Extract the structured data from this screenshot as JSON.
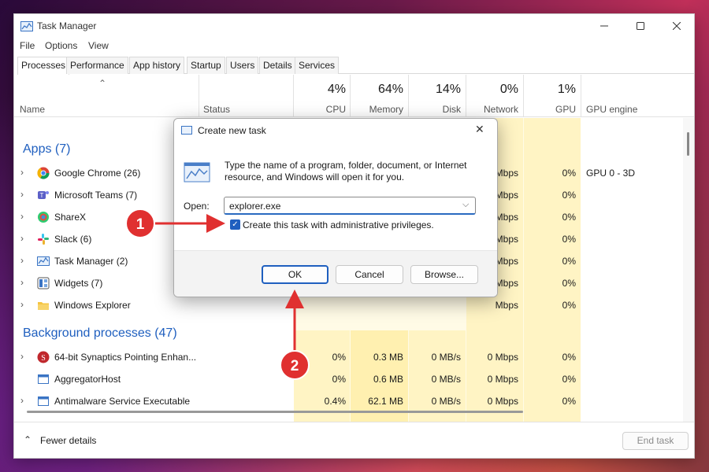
{
  "window": {
    "title": "Task Manager"
  },
  "menu": [
    "File",
    "Options",
    "View"
  ],
  "tabs": [
    "Processes",
    "Performance",
    "App history",
    "Startup",
    "Users",
    "Details",
    "Services"
  ],
  "columns": {
    "name": "Name",
    "status": "Status",
    "cpu": {
      "pct": "4%",
      "label": "CPU"
    },
    "memory": {
      "pct": "64%",
      "label": "Memory"
    },
    "disk": {
      "pct": "14%",
      "label": "Disk"
    },
    "network": {
      "pct": "0%",
      "label": "Network"
    },
    "gpu": {
      "pct": "1%",
      "label": "GPU"
    },
    "gpu_engine": "GPU engine"
  },
  "groups": {
    "apps": "Apps (7)",
    "background": "Background processes (47)"
  },
  "apps": [
    {
      "name": "Google Chrome (26)",
      "network": "Mbps",
      "gpu": "0%",
      "gpu_engine": "GPU 0 - 3D",
      "icon": "chrome-icon",
      "expand": true
    },
    {
      "name": "Microsoft Teams (7)",
      "network": "Mbps",
      "gpu": "0%",
      "icon": "teams-icon",
      "expand": true
    },
    {
      "name": "ShareX",
      "network": "Mbps",
      "gpu": "0%",
      "icon": "sharex-icon",
      "expand": true
    },
    {
      "name": "Slack (6)",
      "network": "Mbps",
      "gpu": "0%",
      "icon": "slack-icon",
      "expand": true
    },
    {
      "name": "Task Manager (2)",
      "network": "Mbps",
      "gpu": "0%",
      "icon": "task-manager-icon",
      "expand": true
    },
    {
      "name": "Widgets (7)",
      "network": "Mbps",
      "gpu": "0%",
      "icon": "widgets-icon",
      "expand": true
    },
    {
      "name": "Windows Explorer",
      "network": "Mbps",
      "gpu": "0%",
      "icon": "folder-icon",
      "expand": true
    }
  ],
  "background": [
    {
      "name": "64-bit Synaptics Pointing Enhan...",
      "cpu": "0%",
      "memory": "0.3 MB",
      "disk": "0 MB/s",
      "network": "0 Mbps",
      "gpu": "0%",
      "expand": true
    },
    {
      "name": "AggregatorHost",
      "cpu": "0%",
      "memory": "0.6 MB",
      "disk": "0 MB/s",
      "network": "0 Mbps",
      "gpu": "0%",
      "expand": false
    },
    {
      "name": "Antimalware Service Executable",
      "cpu": "0.4%",
      "memory": "62.1 MB",
      "disk": "0 MB/s",
      "network": "0 Mbps",
      "gpu": "0%",
      "expand": true
    }
  ],
  "footer": {
    "fewer_details": "Fewer details",
    "end_task": "End task"
  },
  "dialog": {
    "title": "Create new task",
    "description": "Type the name of a program, folder, document, or Internet resource, and Windows will open it for you.",
    "open_label": "Open:",
    "open_value": "explorer.exe",
    "admin_checkbox_label": "Create this task with administrative privileges.",
    "admin_checked": true,
    "ok": "OK",
    "cancel": "Cancel",
    "browse": "Browse..."
  },
  "annotations": {
    "step1": "1",
    "step2": "2",
    "color": "#e03030"
  },
  "colors": {
    "accent": "#1f5fbf",
    "heat": "#fff4c4",
    "group_title": "#1f5fbf"
  }
}
